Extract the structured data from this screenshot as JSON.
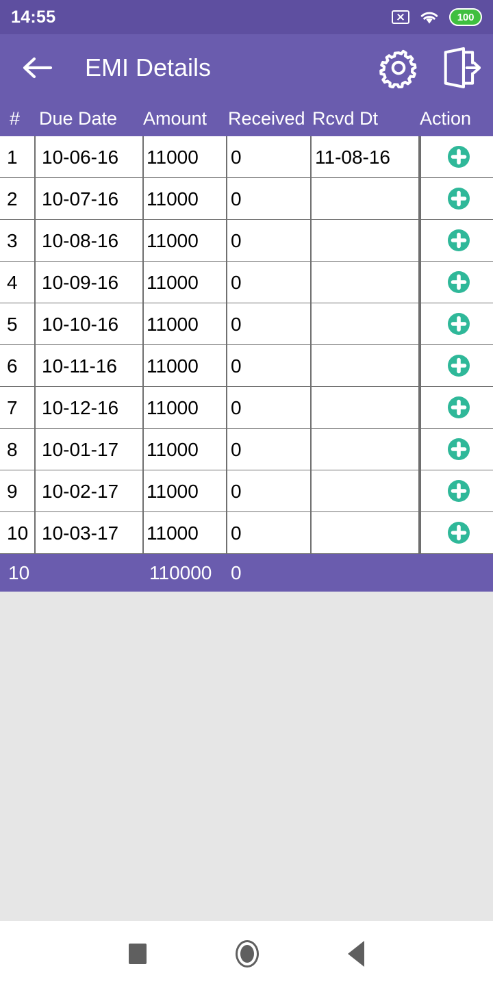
{
  "status_bar": {
    "time": "14:55",
    "battery_level": "100",
    "icons": [
      "no-sim-icon",
      "wifi-icon",
      "battery-icon"
    ],
    "background_color": "#5e4fa0"
  },
  "app_bar": {
    "back_label": "back-arrow-icon",
    "title": "EMI Details",
    "settings_label": "gear-icon",
    "logout_label": "logout-icon",
    "background_color": "#6a5cae"
  },
  "table": {
    "columns": [
      {
        "key": "num",
        "label": "#"
      },
      {
        "key": "due",
        "label": "Due Date"
      },
      {
        "key": "amount",
        "label": "Amount"
      },
      {
        "key": "recv",
        "label": "Received"
      },
      {
        "key": "rdt",
        "label": "Rcvd Dt"
      },
      {
        "key": "action",
        "label": "Action"
      }
    ],
    "rows": [
      {
        "num": "1",
        "due": "10-06-16",
        "amount": "11000",
        "recv": "0",
        "rdt": "11-08-16",
        "action": "plus-icon"
      },
      {
        "num": "2",
        "due": "10-07-16",
        "amount": "11000",
        "recv": "0",
        "rdt": "",
        "action": "plus-icon"
      },
      {
        "num": "3",
        "due": "10-08-16",
        "amount": "11000",
        "recv": "0",
        "rdt": "",
        "action": "plus-icon"
      },
      {
        "num": "4",
        "due": "10-09-16",
        "amount": "11000",
        "recv": "0",
        "rdt": "",
        "action": "plus-icon"
      },
      {
        "num": "5",
        "due": "10-10-16",
        "amount": "11000",
        "recv": "0",
        "rdt": "",
        "action": "plus-icon"
      },
      {
        "num": "6",
        "due": "10-11-16",
        "amount": "11000",
        "recv": "0",
        "rdt": "",
        "action": "plus-icon"
      },
      {
        "num": "7",
        "due": "10-12-16",
        "amount": "11000",
        "recv": "0",
        "rdt": "",
        "action": "plus-icon"
      },
      {
        "num": "8",
        "due": "10-01-17",
        "amount": "11000",
        "recv": "0",
        "rdt": "",
        "action": "plus-icon"
      },
      {
        "num": "9",
        "due": "10-02-17",
        "amount": "11000",
        "recv": "0",
        "rdt": "",
        "action": "plus-icon"
      },
      {
        "num": "10",
        "due": "10-03-17",
        "amount": "11000",
        "recv": "0",
        "rdt": "",
        "action": "plus-icon"
      }
    ],
    "footer": {
      "count": "10",
      "amount_total": "110000",
      "received_total": "0"
    },
    "accent_color": "#2fb899",
    "border_color": "#707070"
  },
  "nav_bar": {
    "recents_label": "recents-square-icon",
    "home_label": "home-circle-icon",
    "back_label": "back-triangle-icon"
  }
}
